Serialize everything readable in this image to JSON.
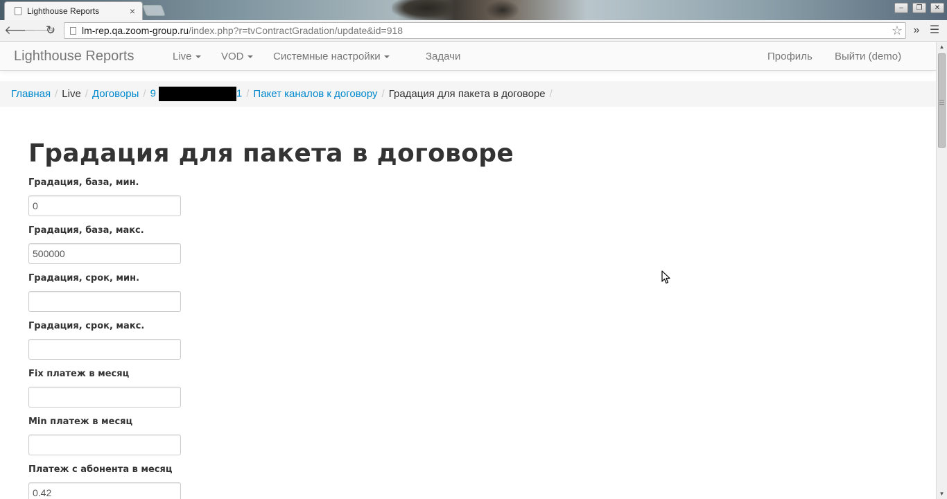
{
  "browser": {
    "tab_title": "Lighthouse Reports",
    "tab_close": "×",
    "url_host": "lm-rep.qa.zoom-group.ru",
    "url_rest": "/index.php?r=tvContractGradation/update&id=918",
    "icons": [
      "back-icon",
      "forward-icon",
      "reload-icon",
      "star-icon",
      "extensions-icon",
      "menu-icon"
    ]
  },
  "navbar": {
    "brand": "Lighthouse Reports",
    "items": [
      {
        "label": "Live",
        "dropdown": true
      },
      {
        "label": "VOD",
        "dropdown": true
      },
      {
        "label": "Системные настройки",
        "dropdown": true
      },
      {
        "label": "Задачи",
        "dropdown": false
      }
    ],
    "right": {
      "profile": "Профиль",
      "logout": "Выйти (demo)"
    }
  },
  "breadcrumb": {
    "home": "Главная",
    "live": "Live",
    "contracts": "Договоры",
    "contract_prefix": "9",
    "contract_suffix": "1",
    "package": "Пакет каналов к договору",
    "current": "Градация для пакета в договоре",
    "divider": "/"
  },
  "page": {
    "title": "Градация для пакета в договоре"
  },
  "form": {
    "fields": [
      {
        "label": "Градация, база, мин.",
        "value": "0"
      },
      {
        "label": "Градация, база, макс.",
        "value": "500000"
      },
      {
        "label": "Градация, срок, мин.",
        "value": ""
      },
      {
        "label": "Градация, срок, макс.",
        "value": ""
      },
      {
        "label": "Fix платеж в месяц",
        "value": ""
      },
      {
        "label": "Min платеж в месяц",
        "value": ""
      },
      {
        "label": "Платеж с абонента в месяц",
        "value": "0.42"
      }
    ]
  },
  "colors": {
    "link": "#0088cc",
    "title": "#333333",
    "navbar_text": "#777777",
    "breadcrumb_bg": "#f5f5f5"
  }
}
